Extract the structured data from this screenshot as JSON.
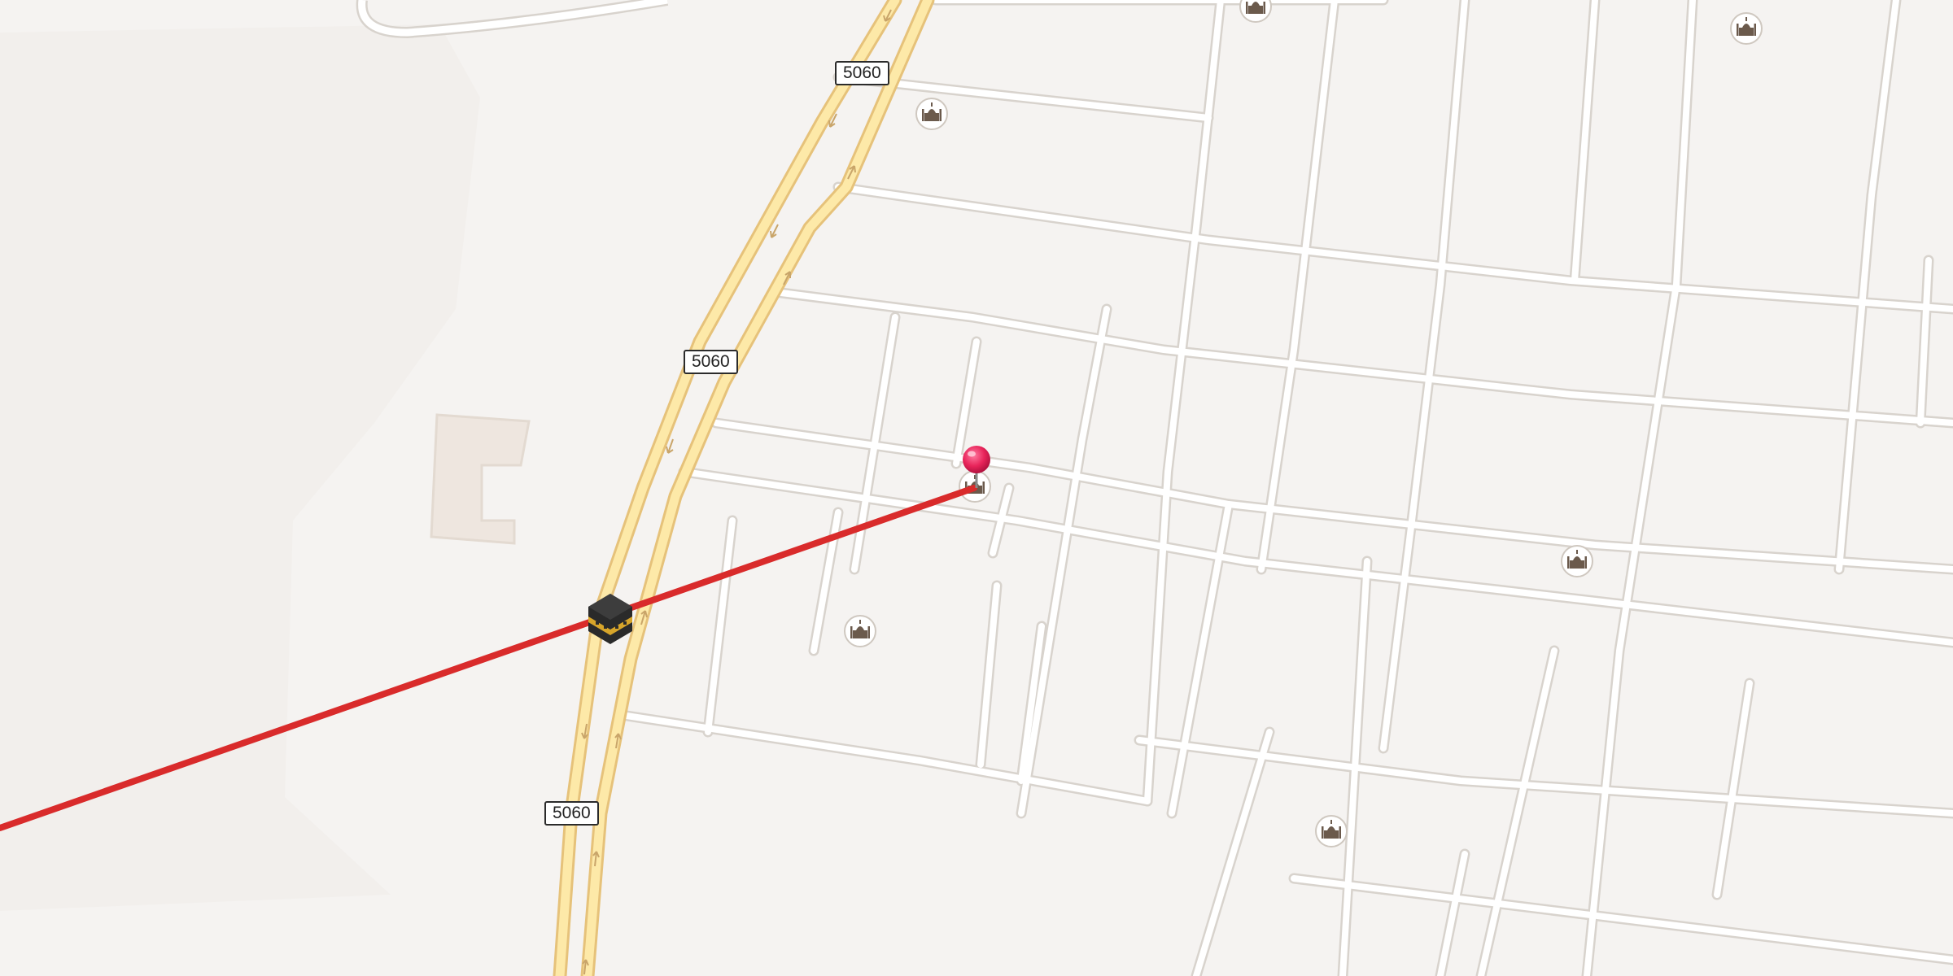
{
  "map": {
    "road_shields": [
      {
        "label": "5060"
      },
      {
        "label": "5060"
      },
      {
        "label": "5060"
      }
    ],
    "markers": {
      "origin": {
        "icon": "kaaba-icon"
      },
      "destination": {
        "icon": "red-pin-icon"
      }
    },
    "poi_icons": [
      {
        "icon": "mosque-icon"
      },
      {
        "icon": "mosque-icon"
      },
      {
        "icon": "mosque-icon"
      },
      {
        "icon": "mosque-icon"
      },
      {
        "icon": "mosque-icon"
      },
      {
        "icon": "mosque-icon"
      },
      {
        "icon": "mosque-icon"
      }
    ],
    "colors": {
      "background": "#f5f3f1",
      "road_fill": "#fde9a8",
      "road_casing": "#e6c27a",
      "street": "#ffffff",
      "street_casing": "#d8d3cd",
      "direction_line": "#d92b2b",
      "pin": "#e8245a",
      "poi": "#6b5a4c"
    }
  }
}
